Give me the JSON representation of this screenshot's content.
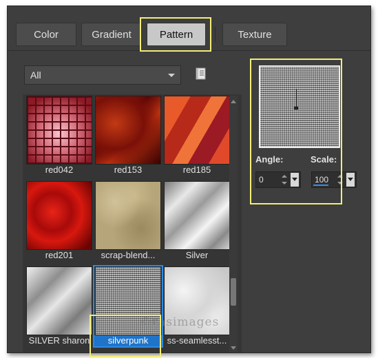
{
  "tabs": [
    {
      "label": "Color",
      "active": false
    },
    {
      "label": "Gradient",
      "active": false
    },
    {
      "label": "Pattern",
      "active": true
    },
    {
      "label": "Texture",
      "active": false
    }
  ],
  "category_filter": {
    "selected": "All"
  },
  "patterns": [
    {
      "label": "red042",
      "selected": false
    },
    {
      "label": "red153",
      "selected": false
    },
    {
      "label": "red185",
      "selected": false
    },
    {
      "label": "red201",
      "selected": false
    },
    {
      "label": "scrap-blend...",
      "selected": false
    },
    {
      "label": "Silver",
      "selected": false
    },
    {
      "label": "SILVER sharon",
      "selected": false
    },
    {
      "label": "silverpunk",
      "selected": true
    },
    {
      "label": "ss-seamlesst...",
      "selected": false
    }
  ],
  "angle": {
    "label": "Angle:",
    "value": "0"
  },
  "scale": {
    "label": "Scale:",
    "value": "100"
  },
  "watermark": "©rasimages",
  "colors": {
    "dialog_bg": "#3e3e3e",
    "highlight": "#f4ee7a",
    "selection": "#1f74c9"
  }
}
